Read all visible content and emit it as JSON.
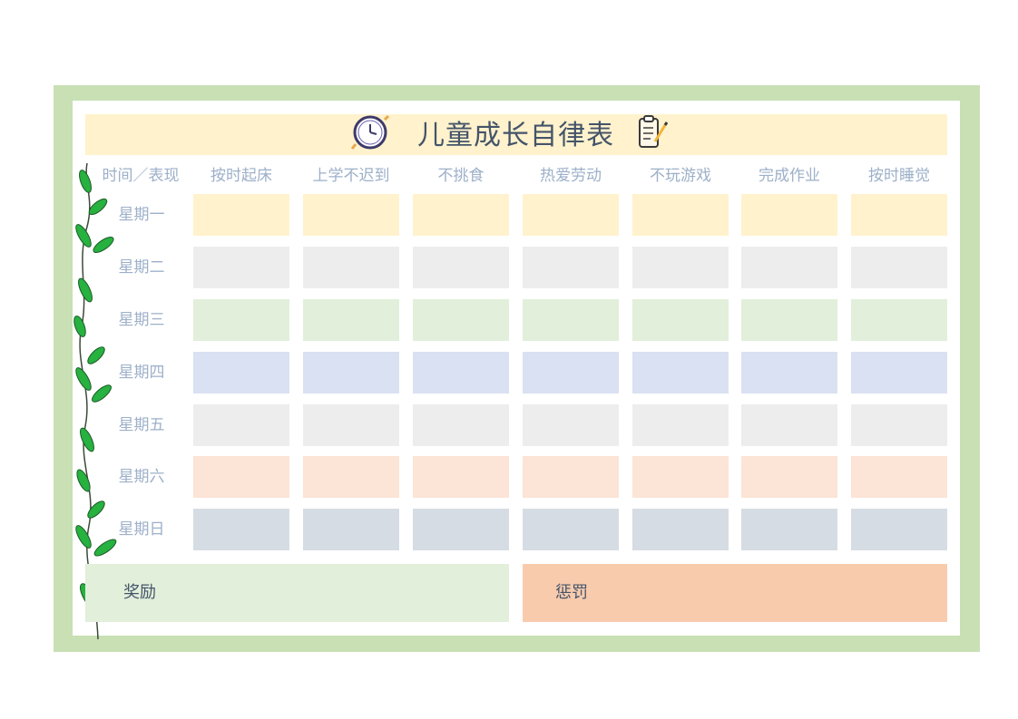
{
  "title": "儿童成长自律表",
  "header_first": "时间／表现",
  "columns": [
    "按时起床",
    "上学不迟到",
    "不挑食",
    "热爱劳动",
    "不玩游戏",
    "完成作业",
    "按时睡觉"
  ],
  "days": [
    {
      "label": "星期一",
      "color": "#fff2cc"
    },
    {
      "label": "星期二",
      "color": "#ededed"
    },
    {
      "label": "星期三",
      "color": "#e2efda"
    },
    {
      "label": "星期四",
      "color": "#d9e1f2"
    },
    {
      "label": "星期五",
      "color": "#ededed"
    },
    {
      "label": "星期六",
      "color": "#fce4d6"
    },
    {
      "label": "星期日",
      "color": "#d6dce4"
    }
  ],
  "reward": {
    "label": "奖励",
    "color": "#e2efda"
  },
  "punish": {
    "label": "惩罚",
    "color": "#f8cbad"
  },
  "colors": {
    "frame": "#c8e0b4",
    "title_band": "#fff2cc",
    "header_text": "#9db0c9",
    "title_text": "#44546a"
  },
  "icons": [
    "clock-icon",
    "clipboard-icon",
    "vine-decoration"
  ]
}
